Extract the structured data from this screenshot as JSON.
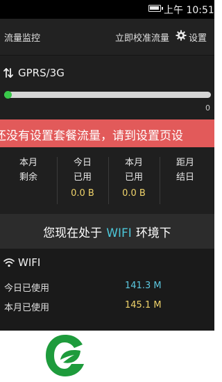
{
  "status_bar": {
    "time": "上午 10:51"
  },
  "header": {
    "title": "流量监控",
    "calibrate_label": "立即校准流量",
    "settings_label": "设置",
    "settings_icon": "gear-icon"
  },
  "gprs": {
    "title": "GPRS/3G",
    "icon": "up-down-arrows-icon",
    "progress_value": "0",
    "progress_fraction": 0,
    "warning": "还没有设置套餐流量，请到设置页设",
    "stats": [
      {
        "line1": "本月",
        "line2": "剩余",
        "value": ""
      },
      {
        "line1": "今日",
        "line2": "已用",
        "value": "0.0 B"
      },
      {
        "line1": "本月",
        "line2": "已用",
        "value": "0.0 B"
      },
      {
        "line1": "距月",
        "line2": "结日",
        "value": ""
      }
    ]
  },
  "environment": {
    "prefix": "您现在处于",
    "network": "WIFI",
    "suffix": "环境下"
  },
  "wifi": {
    "title": "WIFI",
    "icon": "wifi-icon",
    "rows": [
      {
        "label": "今日已使用",
        "value": "141.3 M",
        "color": "#5cc8e0"
      },
      {
        "label": "本月已使用",
        "value": "145.1 M",
        "color": "#f0d36a"
      }
    ]
  },
  "colors": {
    "accent_cyan": "#4cc6d8",
    "accent_yellow": "#f0d36a",
    "warning_red": "#e25a5a",
    "progress_green": "#39c94a",
    "logo_green": "#1e9b3c"
  },
  "logo": {
    "icon": "leaf-logo-icon"
  }
}
